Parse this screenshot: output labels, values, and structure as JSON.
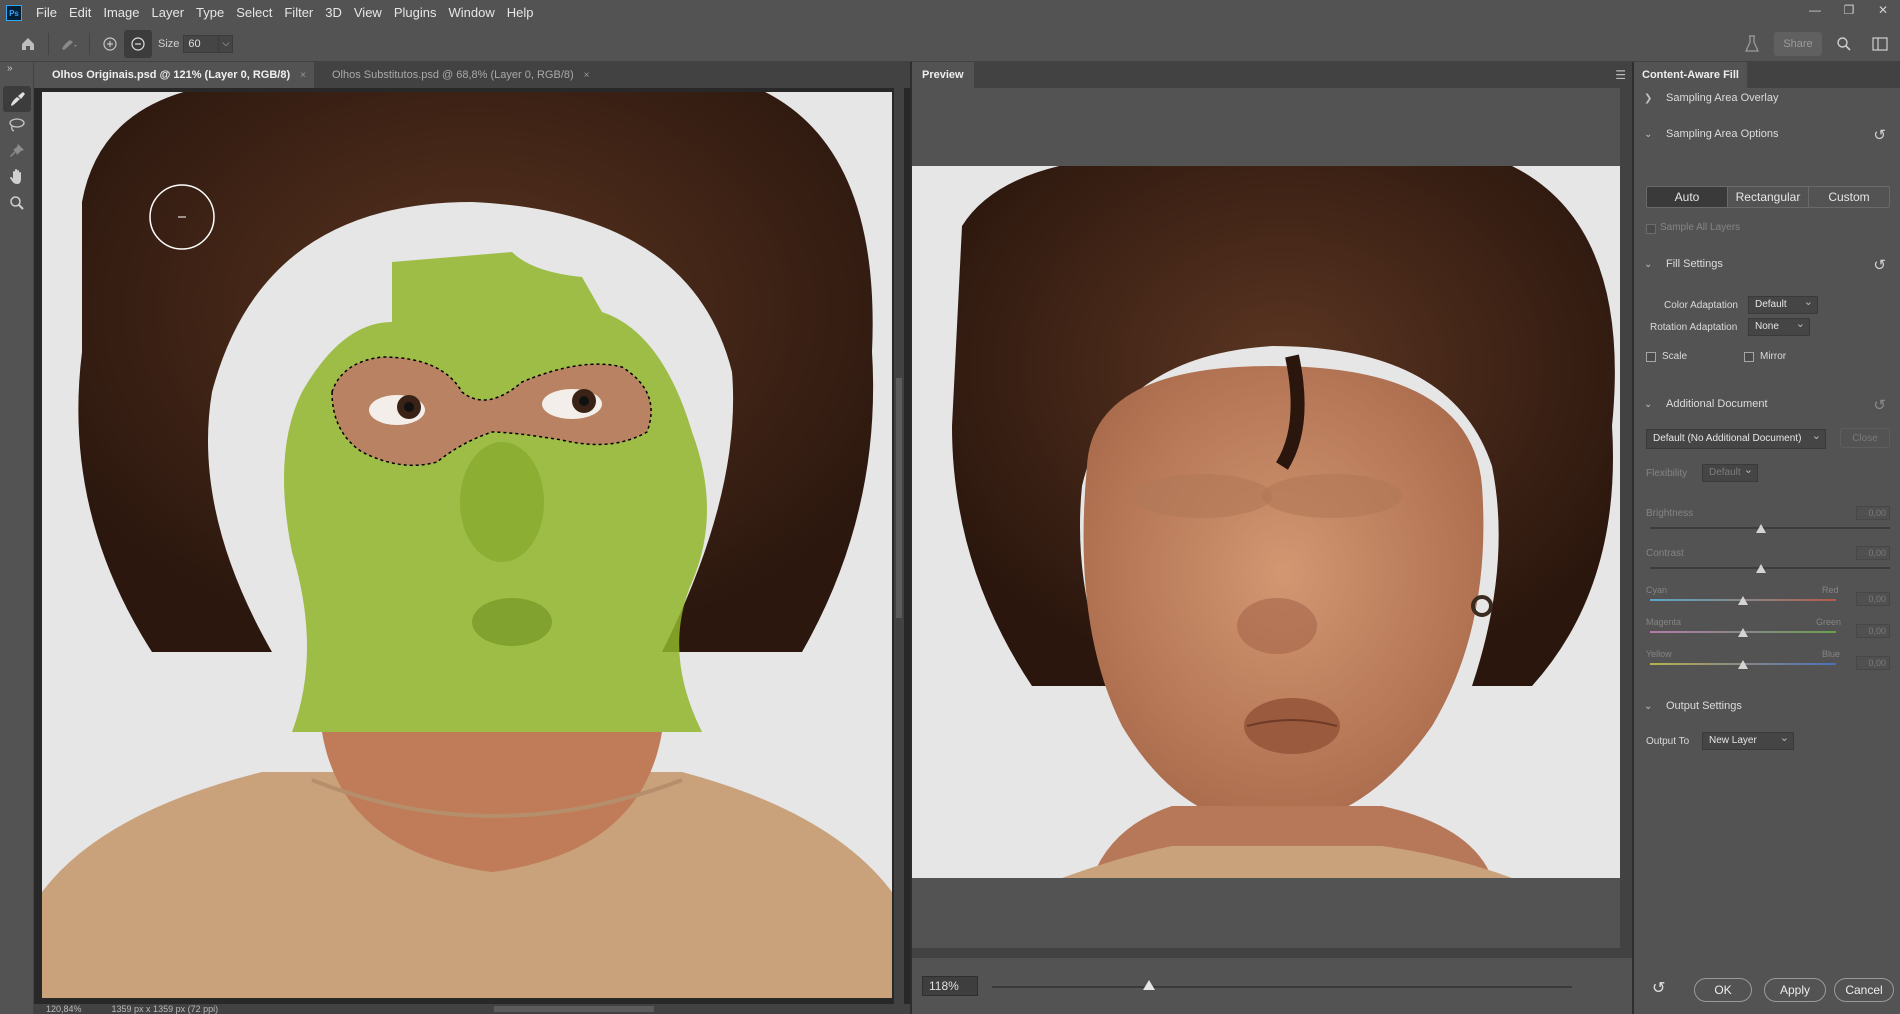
{
  "app": {
    "logo": "Ps"
  },
  "menu": [
    "File",
    "Edit",
    "Image",
    "Layer",
    "Type",
    "Select",
    "Filter",
    "3D",
    "View",
    "Plugins",
    "Window",
    "Help"
  ],
  "window_controls": {
    "minimize": "—",
    "restore": "❐",
    "close": "✕"
  },
  "options": {
    "size_label": "Size",
    "size_value": "60",
    "share_label": "Share"
  },
  "tabs": [
    {
      "label": "Olhos Originais.psd @ 121% (Layer 0, RGB/8)",
      "close": "×"
    },
    {
      "label": "Olhos Substitutos.psd @ 68,8% (Layer 0, RGB/8)",
      "close": "×"
    }
  ],
  "status": {
    "zoom": "120,84%",
    "doc_size": "1359 px x 1359 px (72 ppi)"
  },
  "preview": {
    "title": "Preview",
    "zoom": "118%",
    "zoom_fraction": 0.27
  },
  "props": {
    "title": "Content-Aware Fill",
    "sampling_overlay": "Sampling Area Overlay",
    "sampling_options": "Sampling Area Options",
    "modes": [
      "Auto",
      "Rectangular",
      "Custom"
    ],
    "selected_mode": "Auto",
    "sample_all_layers": "Sample All Layers",
    "fill_settings": "Fill Settings",
    "color_adaptation_label": "Color Adaptation",
    "color_adaptation_value": "Default",
    "rotation_adaptation_label": "Rotation Adaptation",
    "rotation_adaptation_value": "None",
    "scale_label": "Scale",
    "mirror_label": "Mirror",
    "additional_document": "Additional Document",
    "additional_document_value": "Default (No Additional Document)",
    "close_label": "Close",
    "flexibility_label": "Flexibility",
    "flexibility_value": "Default",
    "brightness_label": "Brightness",
    "brightness_value": "0,00",
    "contrast_label": "Contrast",
    "contrast_value": "0,00",
    "cyan_label": "Cyan",
    "red_label": "Red",
    "cyan_value": "0,00",
    "magenta_label": "Magenta",
    "green_label": "Green",
    "magenta_value": "0,00",
    "yellow_label": "Yellow",
    "blue_label": "Blue",
    "yellow_value": "0,00",
    "output_settings": "Output Settings",
    "output_to_label": "Output To",
    "output_to_value": "New Layer"
  },
  "footer": {
    "ok": "OK",
    "apply": "Apply",
    "cancel": "Cancel"
  },
  "colors": {
    "panel": "#535353",
    "dark": "#424242",
    "mask": "#8fb52a",
    "hair": "#3b2418",
    "skin": "#c98b66",
    "shirt": "#c9a27c",
    "accent": "#31a8ff"
  }
}
